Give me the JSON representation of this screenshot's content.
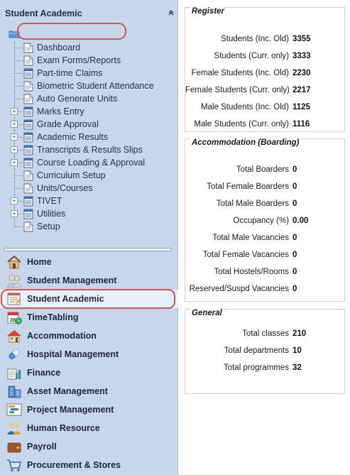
{
  "sidebar": {
    "title": "Student Academic",
    "tree": [
      {
        "label": "Dashboard",
        "icon": "document-icon",
        "expandable": false
      },
      {
        "label": "Exam Forms/Reports",
        "icon": "document-icon",
        "expandable": false
      },
      {
        "label": "Part-time Claims",
        "icon": "form-icon",
        "expandable": false
      },
      {
        "label": "Biometric Student Attendance",
        "icon": "document-icon",
        "expandable": false
      },
      {
        "label": "Auto Generate Units",
        "icon": "document-icon",
        "expandable": false
      },
      {
        "label": "Marks Entry",
        "icon": "form-icon",
        "expandable": true
      },
      {
        "label": "Grade Approval",
        "icon": "form-icon",
        "expandable": true
      },
      {
        "label": "Academic Results",
        "icon": "form-icon",
        "expandable": true
      },
      {
        "label": "Transcripts & Results Slips",
        "icon": "form-icon",
        "expandable": true
      },
      {
        "label": "Course Loading & Approval",
        "icon": "form-icon",
        "expandable": true
      },
      {
        "label": "Curriculum Setup",
        "icon": "document-icon",
        "expandable": false
      },
      {
        "label": "Units/Courses",
        "icon": "document-icon",
        "expandable": false
      },
      {
        "label": "TIVET",
        "icon": "form-icon",
        "expandable": true
      },
      {
        "label": "Utilities",
        "icon": "form-icon",
        "expandable": true
      },
      {
        "label": "Setup",
        "icon": "document-icon",
        "expandable": false
      }
    ],
    "modules": [
      {
        "label": "Home",
        "icon": "home-icon"
      },
      {
        "label": "Student Management",
        "icon": "students-icon"
      },
      {
        "label": "Student Academic",
        "icon": "notepad-icon"
      },
      {
        "label": "TimeTabling",
        "icon": "calendar-icon"
      },
      {
        "label": "Accommodation",
        "icon": "house-icon"
      },
      {
        "label": "Hospital Management",
        "icon": "capsule-icon"
      },
      {
        "label": "Finance",
        "icon": "finance-icon"
      },
      {
        "label": "Asset Management",
        "icon": "building-icon"
      },
      {
        "label": "Project Management",
        "icon": "project-icon"
      },
      {
        "label": "Human Resource",
        "icon": "people-icon"
      },
      {
        "label": "Payroll",
        "icon": "wallet-icon"
      },
      {
        "label": "Procurement & Stores",
        "icon": "cart-icon"
      }
    ]
  },
  "register": {
    "title": "Register",
    "rows": [
      {
        "label": "Students (Inc. Old)",
        "value": "3355"
      },
      {
        "label": "Students (Curr. only)",
        "value": "3333"
      },
      {
        "label": "Female Students (Inc. Old)",
        "value": "2230"
      },
      {
        "label": "Female Students (Curr. only)",
        "value": "2217"
      },
      {
        "label": "Male Students (Inc. Old)",
        "value": "1125"
      },
      {
        "label": "Male Students (Curr. only)",
        "value": "1116"
      }
    ]
  },
  "accommodation": {
    "title": "Accommodation (Boarding)",
    "rows": [
      {
        "label": "Total Boarders",
        "value": "0"
      },
      {
        "label": "Total Female Boarders",
        "value": "0"
      },
      {
        "label": "Total Male Boarders",
        "value": "0"
      },
      {
        "label": "Occupancy (%)",
        "value": "0.00"
      },
      {
        "label": "Total Male Vacancies",
        "value": "0"
      },
      {
        "label": "Total Female Vacancies",
        "value": "0"
      },
      {
        "label": "Total Hostels/Rooms",
        "value": "0"
      },
      {
        "label": "Reserved/Suspd Vacancies",
        "value": "0"
      }
    ]
  },
  "general": {
    "title": "General",
    "rows": [
      {
        "label": "Total classes",
        "value": "210"
      },
      {
        "label": "Total departments",
        "value": "10"
      },
      {
        "label": "Total programmes",
        "value": "32"
      }
    ]
  }
}
